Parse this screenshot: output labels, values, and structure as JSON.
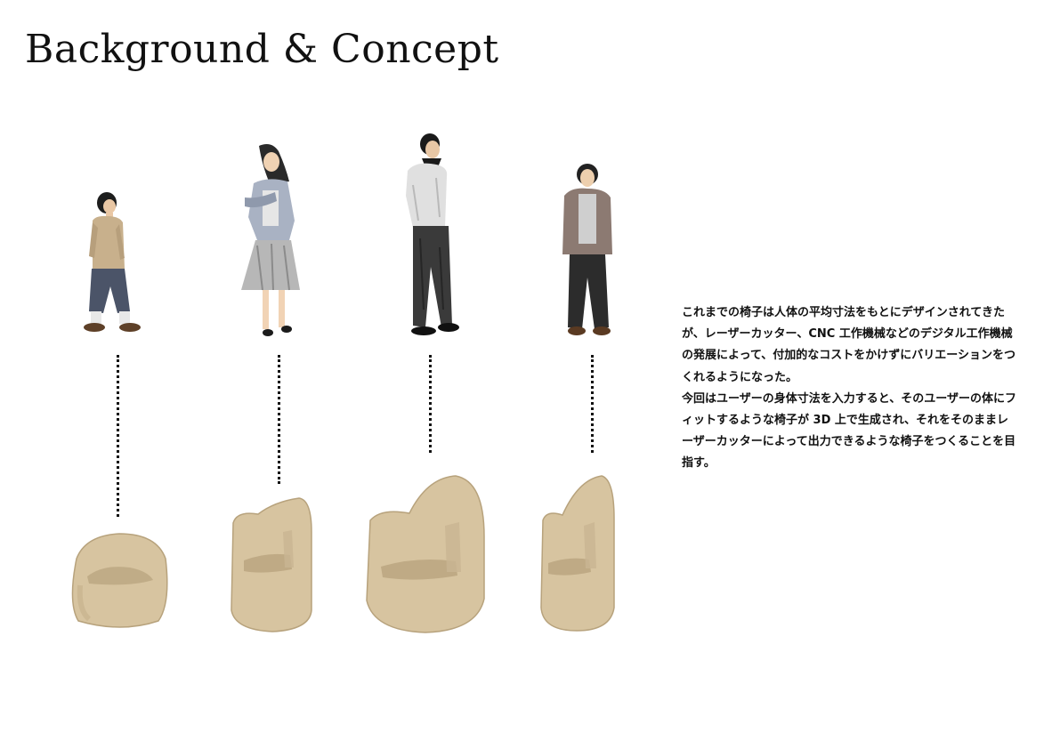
{
  "page": {
    "title": "Background & Concept"
  },
  "concept": {
    "paragraphs": [
      "これまでの椅子は人体の平均寸法をもとにデザインされてきたが、レーザーカッター、CNC 工作機械などのデジタル工作機械の発展によって、付加的なコストをかけずにバリエーションをつくれるようになった。",
      "今回はユーザーの身体寸法を入力すると、そのユーザーの体にフィットするような椅子が 3D 上で生成され、それをそのままレーザーカッターによって出力できるような椅子をつくることを目指す。"
    ]
  },
  "colors": {
    "chair": "#d7c4a0",
    "chair_shadow": "#b7a27c",
    "dots": "#111111"
  }
}
